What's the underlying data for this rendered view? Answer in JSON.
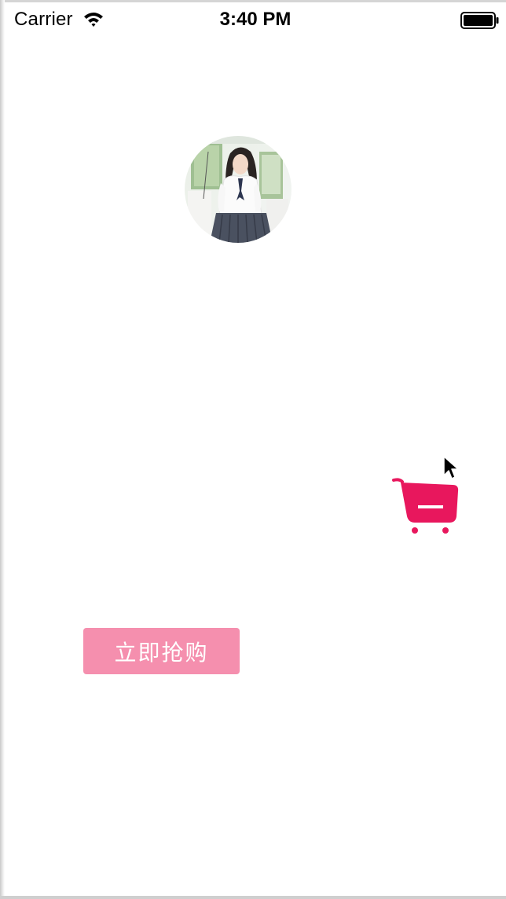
{
  "status_bar": {
    "carrier": "Carrier",
    "time": "3:40 PM",
    "wifi_icon": "wifi-icon",
    "battery_icon": "battery-full-icon"
  },
  "avatar": {
    "description_icon": "avatar-photo"
  },
  "cart": {
    "icon": "shopping-cart-minus-icon",
    "color": "#e8175d"
  },
  "buy_button": {
    "label": "立即抢购",
    "color": "#f58fae"
  },
  "cursor": {
    "icon": "mouse-pointer-icon"
  }
}
